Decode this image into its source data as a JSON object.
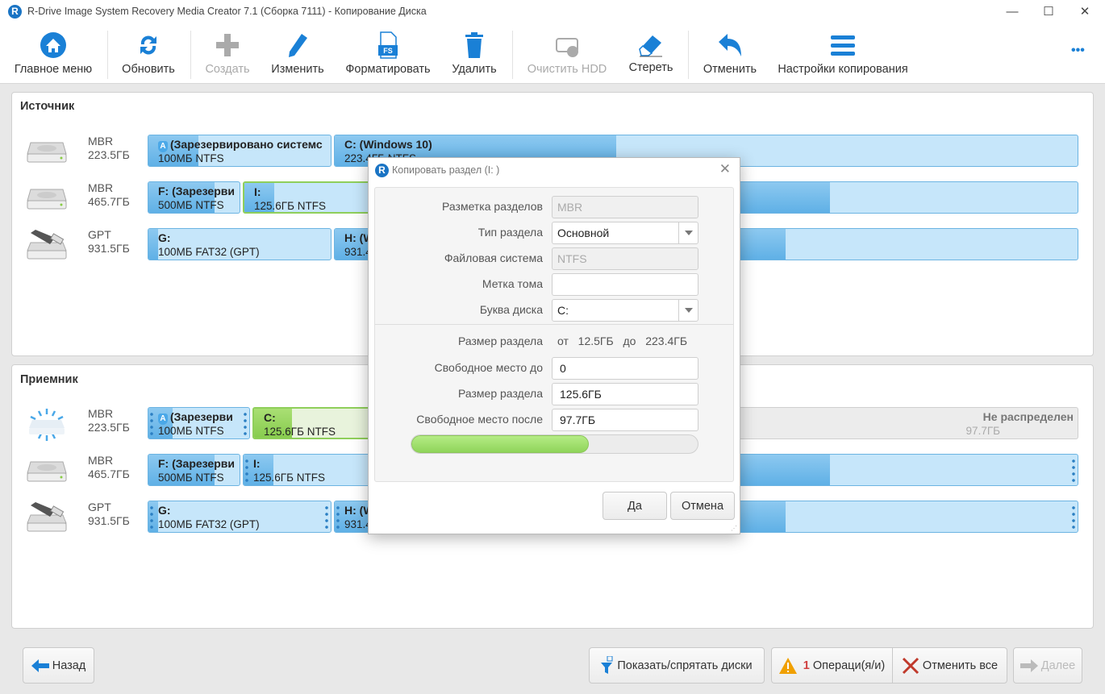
{
  "window": {
    "title": "R-Drive Image System Recovery Media Creator 7.1 (Сборка 7111) - Копирование Диска"
  },
  "toolbar": {
    "items": [
      {
        "label": "Главное меню",
        "icon": "home-icon",
        "enabled": true
      },
      {
        "label": "Обновить",
        "icon": "refresh-icon",
        "enabled": true
      },
      {
        "label": "Создать",
        "icon": "plus-icon",
        "enabled": false
      },
      {
        "label": "Изменить",
        "icon": "pencil-icon",
        "enabled": true
      },
      {
        "label": "Форматировать",
        "icon": "format-fs-icon",
        "enabled": true
      },
      {
        "label": "Удалить",
        "icon": "trash-icon",
        "enabled": true
      },
      {
        "label": "Очистить HDD",
        "icon": "wipe-hdd-icon",
        "enabled": false
      },
      {
        "label": "Стереть",
        "icon": "eraser-icon",
        "enabled": true
      },
      {
        "label": "Отменить",
        "icon": "undo-icon",
        "enabled": true
      },
      {
        "label": "Настройки копирования",
        "icon": "menu-lines-icon",
        "enabled": true
      }
    ],
    "more": "•••"
  },
  "source": {
    "title": "Источник",
    "disks": [
      {
        "scheme": "MBR",
        "size": "223.5ГБ",
        "icon": "hdd-icon",
        "parts": [
          {
            "name": "(Зарезервировано системс",
            "info": "100МБ NTFS"
          },
          {
            "name": "C: (Windows 10)",
            "info": "223.4ГБ NTFS"
          }
        ]
      },
      {
        "scheme": "MBR",
        "size": "465.7ГБ",
        "icon": "hdd-icon",
        "parts": [
          {
            "name": "F: (Зарезерви",
            "info": "500МБ NTFS"
          },
          {
            "name": "I:",
            "info": "125.6ГБ NTFS"
          },
          {
            "name": "",
            "info": "ГБ NTFS"
          }
        ]
      },
      {
        "scheme": "GPT",
        "size": "931.5ГБ",
        "icon": "usb-drive-icon",
        "parts": [
          {
            "name": "G:",
            "info": "100МБ FAT32 (GPT)"
          },
          {
            "name": "H: (W",
            "info": "931.4"
          }
        ]
      }
    ]
  },
  "target": {
    "title": "Приемник",
    "disks": [
      {
        "scheme": "MBR",
        "size": "223.5ГБ",
        "icon": "hdd-flash-icon",
        "parts": [
          {
            "name": "(Зарезерви",
            "info": "100МБ NTFS"
          },
          {
            "name": "C:",
            "info": "125.6ГБ NTFS"
          },
          {
            "name": "Не распределен",
            "info": "97.7ГБ"
          }
        ]
      },
      {
        "scheme": "MBR",
        "size": "465.7ГБ",
        "icon": "hdd-icon",
        "parts": [
          {
            "name": "F: (Зарезерви",
            "info": "500МБ NTFS"
          },
          {
            "name": "I:",
            "info": "125.6ГБ NTFS"
          },
          {
            "name": "",
            "info": "ГБ NTFS"
          }
        ]
      },
      {
        "scheme": "GPT",
        "size": "931.5ГБ",
        "icon": "usb-drive-icon",
        "parts": [
          {
            "name": "G:",
            "info": "100МБ FAT32 (GPT)"
          },
          {
            "name": "H: (W",
            "info": "931.4"
          }
        ]
      }
    ]
  },
  "dialog": {
    "title": "Копировать раздел (I: )",
    "fields": {
      "partition_scheme": {
        "label": "Разметка разделов",
        "value": "MBR"
      },
      "partition_type": {
        "label": "Тип раздела",
        "value": "Основной"
      },
      "file_system": {
        "label": "Файловая система",
        "value": "NTFS"
      },
      "volume_label": {
        "label": "Метка тома",
        "value": ""
      },
      "drive_letter": {
        "label": "Буква диска",
        "value": "C:"
      }
    },
    "size_range": {
      "label": "Размер раздела",
      "from_word": "от",
      "min": "12.5ГБ",
      "to_word": "до",
      "max": "223.4ГБ"
    },
    "free_before": {
      "label": "Свободное место до",
      "value": "0"
    },
    "part_size": {
      "label": "Размер раздела",
      "value": "125.6ГБ"
    },
    "free_after": {
      "label": "Свободное место после",
      "value": "97.7ГБ"
    },
    "slider_fraction": 0.62,
    "ok": "Да",
    "cancel": "Отмена"
  },
  "bottom": {
    "back": "Назад",
    "show_hide": "Показать/спрятать диски",
    "ops_count": "1",
    "ops_label": "Операци(я/и)",
    "cancel_all": "Отменить все",
    "next": "Далее"
  },
  "colors": {
    "accent": "#1a74c4",
    "partition": "#c6e6fa",
    "selected": "#8fcf5a",
    "warning": "#f0a000",
    "cancel": "#c0392b"
  }
}
